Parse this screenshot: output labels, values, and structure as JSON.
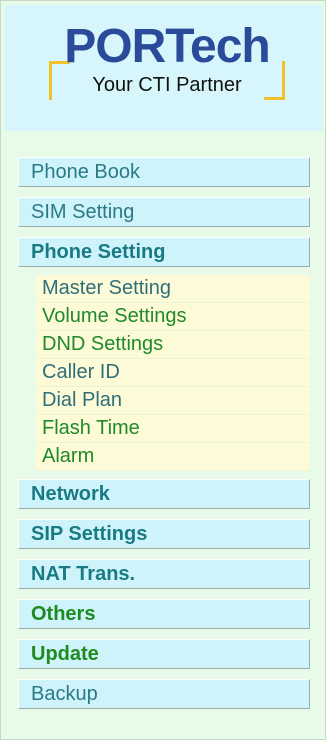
{
  "logo": {
    "title": "PORTech",
    "tagline": "Your CTI Partner"
  },
  "nav": {
    "phone_book": "Phone Book",
    "sim_setting": "SIM Setting",
    "phone_setting": "Phone Setting",
    "sub_items": [
      "Master Setting",
      "Volume Settings",
      "DND Settings",
      "Caller ID",
      "Dial Plan",
      "Flash Time",
      "Alarm"
    ],
    "network": "Network",
    "sip_settings": "SIP Settings",
    "nat_trans": "NAT Trans.",
    "others": "Others",
    "update": "Update",
    "backup": "Backup"
  },
  "colors": {
    "background": "#e6fae6",
    "header_bg": "#d7f6fb",
    "nav_item_bg": "#cff3fa",
    "sub_item_bg": "#fdfad8",
    "logo_blue": "#2a4a9a",
    "bracket_gold": "#f0c12a",
    "nav_text_teal": "#2b7a86",
    "sub_text_green": "#1f8a2a"
  }
}
